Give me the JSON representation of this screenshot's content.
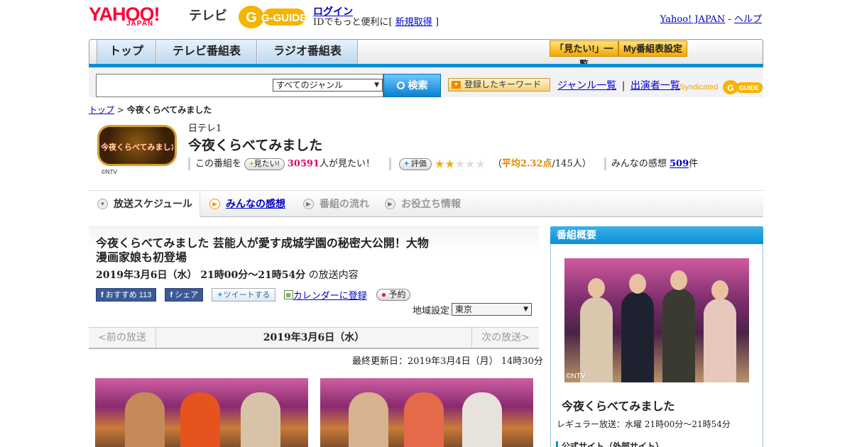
{
  "header": {
    "yahoo_logo": "YAHOO!",
    "japan_logo": "JAPAN",
    "tv_label": "テレビ",
    "gguide_logo": "G-GUIDE",
    "login": "ログイン",
    "login_sub_prefix": "IDでもっと便利に[",
    "register": "新規取得",
    "login_sub_suffix": "]",
    "yahoo_japan_link": "Yahoo! JAPAN",
    "separator": "-",
    "help_link": "ヘルプ"
  },
  "nav": {
    "tabs": [
      "トップ",
      "テレビ番組表",
      "ラジオ番組表"
    ],
    "want_list": "「見たい!」一覧",
    "my_schedule": "My番組表設定"
  },
  "search": {
    "genre": "すべてのジャンル",
    "button": "検索",
    "keyword_button": "登録したキーワード",
    "genre_list": "ジャンル一覧",
    "divider": "|",
    "performer_list": "出演者一覧",
    "syndicated": "Syndicated"
  },
  "breadcrumb": {
    "top": "トップ",
    "separator": ">",
    "current": "今夜くらべてみました"
  },
  "program": {
    "logo_text": "今夜くらべてみました",
    "ntv": "©NTV",
    "channel": "日テレ1",
    "title": "今夜くらべてみました",
    "want_prefix": "この番組を",
    "want_pill": "見たい!",
    "want_count": "30591",
    "want_suffix": "人が見たい！",
    "rating_pill": "評価",
    "rating_stars": 2.32,
    "rating_open": "（",
    "avg_label": "平均2.32点",
    "rating_count": "/145人）",
    "impressions_label": "みんなの感想",
    "impressions_count": "509",
    "impressions_unit": "件"
  },
  "tabs": {
    "schedule": "放送スケジュール",
    "impressions": "みんなの感想",
    "flow": "番組の流れ",
    "info": "お役立ち情報"
  },
  "episode": {
    "title": "今夜くらべてみました 芸能人が愛す成城学園の秘密大公開！大物漫画家娘も初登場",
    "date": "2019年3月6日（水） 21時00分～21時54分",
    "date_suffix": "の放送内容",
    "fb_recommend": "おすすめ",
    "fb_count": "113",
    "fb_share": "シェア",
    "tweet": "ツイートする",
    "calendar": "カレンダーに登録",
    "reserve": "予約",
    "region_label": "地域設定",
    "region_value": "東京",
    "prev": "<前の放送",
    "current_date": "2019年3月6日（水）",
    "next": "次の放送>",
    "last_updated": "最終更新日：2019年3月4日（月） 14時30分"
  },
  "sidebar": {
    "header": "番組概要",
    "ntv": "©NTV",
    "title": "今夜くらべてみました",
    "regular": "レギュラー放送：水曜 21時00分～21時54分",
    "official": "公式サイト（外部サイト）"
  }
}
